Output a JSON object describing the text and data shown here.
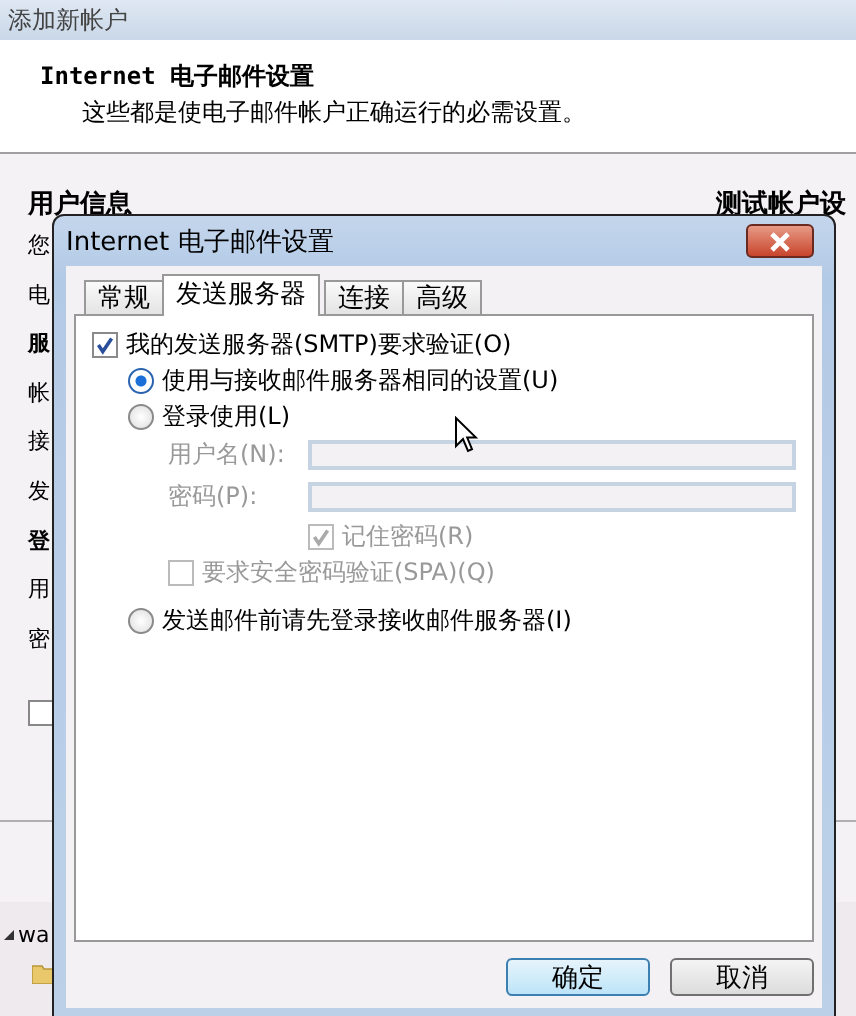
{
  "background_window": {
    "title": "添加新帐户",
    "heading": "Internet 电子邮件设置",
    "subheading": "这些都是使电子邮件帐户正确运行的必需设置。",
    "left_section_title": "用户信息",
    "right_section_title": "测试帐户设",
    "left_fragments": [
      {
        "text": "您",
        "bold": false
      },
      {
        "text": "电",
        "bold": false
      },
      {
        "text": "服",
        "bold": true
      },
      {
        "text": "帐",
        "bold": false
      },
      {
        "text": "接",
        "bold": false
      },
      {
        "text": "发",
        "bold": false
      },
      {
        "text": "登",
        "bold": true
      },
      {
        "text": "用",
        "bold": false
      },
      {
        "text": "密",
        "bold": false
      }
    ],
    "left_checkbox": {
      "checked": false
    },
    "footer_text": "wa"
  },
  "dialog": {
    "title": "Internet 电子邮件设置",
    "tabs": [
      {
        "label": "常规",
        "selected": false
      },
      {
        "label": "发送服务器",
        "selected": true
      },
      {
        "label": "连接",
        "selected": false
      },
      {
        "label": "高级",
        "selected": false
      }
    ],
    "auth_checkbox": {
      "label": "我的发送服务器(SMTP)要求验证(O)",
      "checked": true
    },
    "radios": [
      {
        "label": "使用与接收邮件服务器相同的设置(U)",
        "selected": true
      },
      {
        "label": "登录使用(L)",
        "selected": false,
        "login": {
          "disabled": true,
          "fields": [
            {
              "label": "用户名(N):"
            },
            {
              "label": "密码(P):"
            }
          ],
          "remember": {
            "label": "记住密码(R)",
            "checked": true
          },
          "spa": {
            "label": "要求安全密码验证(SPA)(Q)",
            "checked": false
          }
        }
      },
      {
        "label": "发送邮件前请先登录接收邮件服务器(I)",
        "selected": false
      }
    ],
    "buttons": [
      {
        "label": "确定",
        "default": true
      },
      {
        "label": "取消",
        "default": false
      }
    ]
  }
}
